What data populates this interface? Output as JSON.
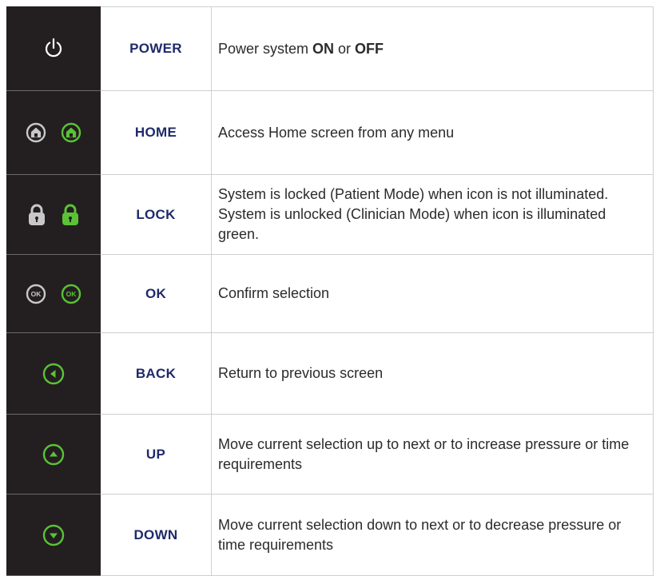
{
  "colors": {
    "label": "#1f2a6b",
    "icon_panel": "#231f20",
    "icon_green": "#5bc236",
    "icon_grey": "#c8c8c8",
    "icon_white": "#ffffff"
  },
  "rows": [
    {
      "label": "POWER",
      "icons": [
        "power-icon-white"
      ],
      "description_parts": [
        {
          "text": "Power system ",
          "bold": false
        },
        {
          "text": "ON",
          "bold": true
        },
        {
          "text": " or ",
          "bold": false
        },
        {
          "text": "OFF",
          "bold": true
        }
      ]
    },
    {
      "label": "HOME",
      "icons": [
        "home-icon-grey",
        "home-icon-green"
      ],
      "description": "Access Home screen from any menu"
    },
    {
      "label": "LOCK",
      "icons": [
        "lock-icon-grey",
        "lock-icon-green"
      ],
      "description": "System is locked (Patient Mode) when icon is not illuminated. System is unlocked (Clinician Mode) when icon is illuminated green."
    },
    {
      "label": "OK",
      "icons": [
        "ok-icon-grey",
        "ok-icon-green"
      ],
      "icon_text": "OK",
      "description": "Confirm selection"
    },
    {
      "label": "BACK",
      "icons": [
        "back-arrow-icon-green"
      ],
      "description": "Return to previous screen"
    },
    {
      "label": "UP",
      "icons": [
        "up-arrow-icon-green"
      ],
      "description": "Move current selection up to next or to increase pressure or time requirements"
    },
    {
      "label": "DOWN",
      "icons": [
        "down-arrow-icon-green"
      ],
      "description": "Move current selection down to next or to decrease pressure or time requirements"
    }
  ]
}
